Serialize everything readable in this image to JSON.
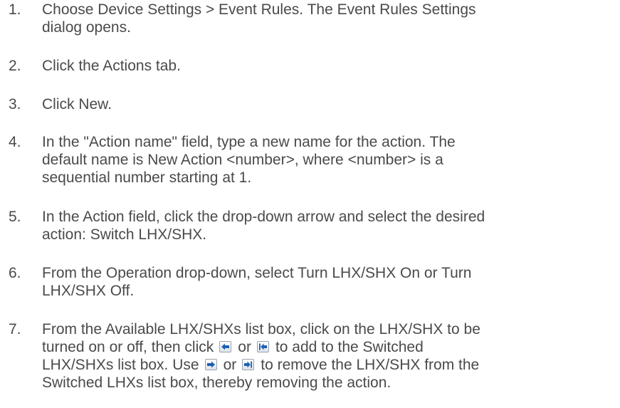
{
  "steps": [
    {
      "num": "1.",
      "lines": [
        "Choose Device Settings > Event Rules. The Event Rules Settings",
        "dialog opens."
      ]
    },
    {
      "num": "2.",
      "lines": [
        "Click the Actions tab."
      ]
    },
    {
      "num": "3.",
      "lines": [
        "Click New."
      ]
    },
    {
      "num": "4.",
      "lines": [
        "In the \"Action name\" field, type a new name for the action. The",
        "default name is New Action <number>, where <number> is a",
        "sequential number starting at 1."
      ]
    },
    {
      "num": "5.",
      "lines": [
        "In the Action field, click the drop-down arrow and select the desired",
        "action: Switch LHX/SHX."
      ]
    },
    {
      "num": "6.",
      "lines": [
        "From the Operation drop-down, select Turn LHX/SHX On or Turn",
        "LHX/SHX Off."
      ]
    },
    {
      "num": "7.",
      "line1": "From the Available LHX/SHXs list box, click on the LHX/SHX to be",
      "line2_a": "turned on or off, then click",
      "line2_b": "or",
      "line2_c": "to add to the Switched",
      "line3_a": "LHX/SHXs list box. Use",
      "line3_b": "or",
      "line3_c": "to remove the LHX/SHX from the",
      "line4": "Switched LHXs list box, thereby removing the action."
    }
  ],
  "icons": [
    "arrow-left-icon",
    "arrow-left-to-start-icon",
    "arrow-right-icon",
    "arrow-right-to-end-icon"
  ],
  "colors": {
    "text": "#4a4a4a",
    "icon_arrow": "#1e5fb4"
  }
}
